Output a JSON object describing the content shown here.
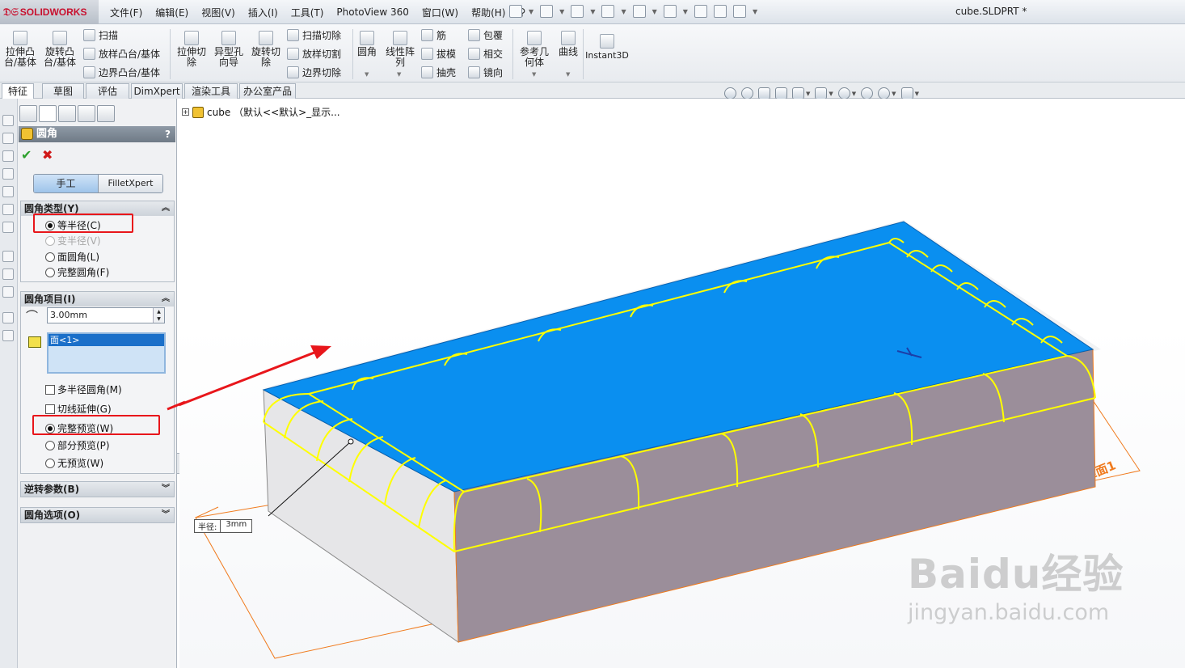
{
  "app": {
    "brand": "SOLIDWORKS",
    "doc_title": "cube.SLDPRT *"
  },
  "menu": [
    "文件(F)",
    "编辑(E)",
    "视图(V)",
    "插入(I)",
    "工具(T)",
    "PhotoView 360",
    "窗口(W)",
    "帮助(H)"
  ],
  "commands": {
    "extrude_boss": "拉伸凸\n台/基体",
    "revolve_boss": "旋转凸\n台/基体",
    "sweep": "扫描",
    "loft_boss": "放样凸台/基体",
    "boundary_boss": "边界凸台/基体",
    "extrude_cut": "拉伸切\n除",
    "hole_wizard": "异型孔\n向导",
    "revolve_cut": "旋转切\n除",
    "swept_cut": "扫描切除",
    "lofted_cut": "放样切割",
    "boundary_cut": "边界切除",
    "fillet": "圆角",
    "linear_pattern": "线性阵\n列",
    "rib": "筋",
    "draft": "拔模",
    "shell": "抽壳",
    "wrap": "包覆",
    "intersect": "相交",
    "mirror": "镜向",
    "ref_geometry": "参考几\n何体",
    "curves": "曲线",
    "instant3d": "Instant3D"
  },
  "tabs": [
    "特征",
    "草图",
    "评估",
    "DimXpert",
    "渲染工具",
    "办公室产品"
  ],
  "feature_tree": {
    "expander": "+",
    "part_label": "cube （默认<<默认>_显示..."
  },
  "property_manager": {
    "title": "圆角",
    "help": "?",
    "ok": "✔",
    "cancel": "✖",
    "mode_manual": "手工",
    "mode_filletxpert": "FilletXpert",
    "fillet_type": {
      "header": "圆角类型(Y)",
      "options": [
        {
          "label": "等半径(C)",
          "selected": true,
          "enabled": true
        },
        {
          "label": "变半径(V)",
          "selected": false,
          "enabled": false
        },
        {
          "label": "面圆角(L)",
          "selected": false,
          "enabled": true
        },
        {
          "label": "完整圆角(F)",
          "selected": false,
          "enabled": true
        }
      ]
    },
    "items": {
      "header": "圆角项目(I)",
      "radius": "3.00mm",
      "selection": "面<1>",
      "multi_radius": "多半径圆角(M)",
      "tangent_propagation": "切线延伸(G)",
      "preview_options": [
        {
          "label": "完整预览(W)",
          "selected": true
        },
        {
          "label": "部分预览(P)",
          "selected": false
        },
        {
          "label": "无预览(W)",
          "selected": false
        }
      ]
    },
    "setback": {
      "header": "逆转参数(B)"
    },
    "fillet_options": {
      "header": "圆角选项(O)"
    },
    "chevron_up": "︽",
    "chevron_down": "︾"
  },
  "graphics": {
    "radius_callout_label": "半径:",
    "radius_callout_value": "3mm",
    "plane_label": "基准面1",
    "colors": {
      "top_face": "#0a8ff0",
      "front_face": "#9b8e9a",
      "side_face": "#e6e6e8",
      "preview": "#ffff00",
      "arrow": "#e8161b",
      "plane": "#f07b1e"
    }
  },
  "watermark": {
    "brand": "Baidu经验",
    "url": "jingyan.baidu.com"
  },
  "icons": {
    "save": "save-icon",
    "undo": "undo-icon",
    "zoom": "zoom-icon"
  }
}
